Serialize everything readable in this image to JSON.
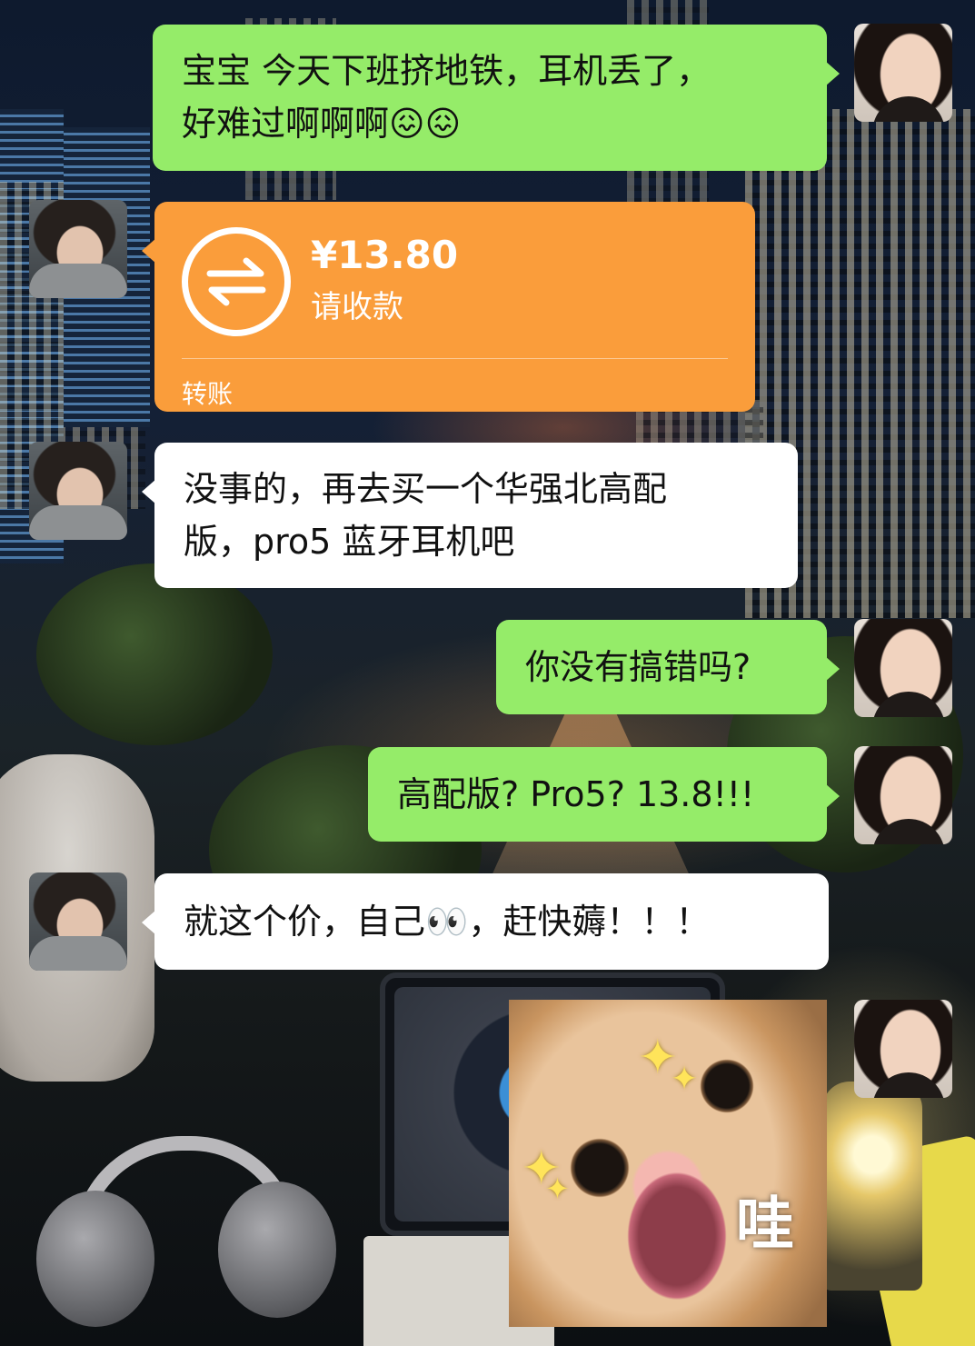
{
  "colors": {
    "sent_bubble": "#95ec69",
    "received_bubble": "#ffffff",
    "transfer_card": "#fa9d3b"
  },
  "messages": [
    {
      "id": "m1",
      "sender": "self",
      "type": "text",
      "text": "宝宝 今天下班挤地铁，耳机丢了，\n好难过啊啊啊😖😖"
    },
    {
      "id": "m2",
      "sender": "other",
      "type": "transfer",
      "amount": "¥13.80",
      "status": "请收款",
      "label": "转账",
      "icon": "transfer-arrows-icon"
    },
    {
      "id": "m3",
      "sender": "other",
      "type": "text",
      "text": "没事的，再去买一个华强北高配\n版，pro5 蓝牙耳机吧"
    },
    {
      "id": "m4",
      "sender": "self",
      "type": "text",
      "text": "你没有搞错吗?"
    },
    {
      "id": "m5",
      "sender": "self",
      "type": "text",
      "text": "高配版? Pro5? 13.8!!!"
    },
    {
      "id": "m6",
      "sender": "other",
      "type": "text",
      "text": "就这个价，自己👀，赶快薅！！！"
    },
    {
      "id": "m7",
      "sender": "self",
      "type": "sticker",
      "caption": "哇",
      "icon": "shocked-cat-sticker"
    }
  ]
}
